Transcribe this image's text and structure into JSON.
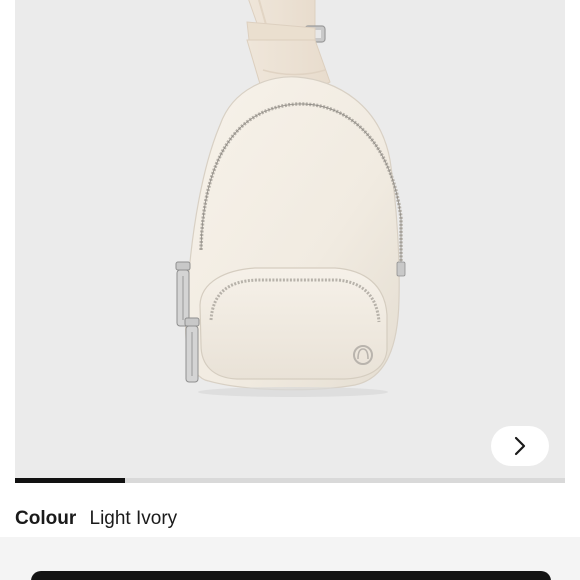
{
  "product": {
    "image_alt": "Light ivory mini sling bag with strap and zipper pockets",
    "colour_label": "Colour",
    "colour_value": "Light Ivory",
    "gallery_progress": 0.2
  },
  "icons": {
    "next": "chevron-right-icon"
  },
  "colors": {
    "background": "#ebebeb",
    "bag": "#f3ede3",
    "accent": "#111111"
  }
}
